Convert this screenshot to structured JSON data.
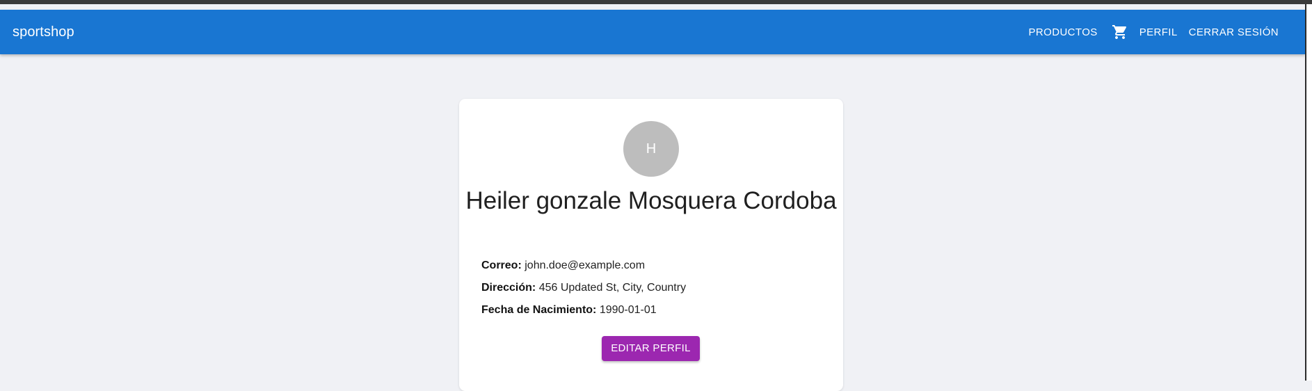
{
  "colors": {
    "appbar": "#1976d2",
    "page_background": "#f0f1f5",
    "avatar": "#bdbdbd",
    "primary_button": "#9c27b0"
  },
  "header": {
    "brand": "sportshop",
    "nav": {
      "products": "PRODUCTOS",
      "cart_icon": "shopping-cart-icon",
      "profile": "PERFIL",
      "logout": "CERRAR SESIÓN"
    }
  },
  "profile": {
    "avatar_initial": "H",
    "full_name": "Heiler gonzale Mosquera Cordoba",
    "fields": {
      "email_label": "Correo:",
      "email_value": "john.doe@example.com",
      "address_label": "Dirección:",
      "address_value": "456 Updated St, City, Country",
      "birth_label": "Fecha de Nacimiento:",
      "birth_value": "1990-01-01"
    },
    "edit_button": "EDITAR PERFIL"
  }
}
